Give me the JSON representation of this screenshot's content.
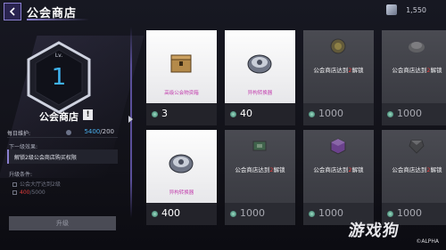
{
  "header": {
    "title": "公会商店",
    "currency_value": "1,550"
  },
  "guild": {
    "lv_label": "Lv.",
    "level": "1",
    "name": "公会商店",
    "info_symbol": "!",
    "maintenance_label": "每日维护:",
    "maintenance_current": "5400",
    "maintenance_max": "/200",
    "next_label": "下一级效果:",
    "next_effect": "解锁2级公会商店购买权限",
    "conditions_label": "升级条件:",
    "condition_1": "公会大厅达到2级",
    "condition_2_current": "400",
    "condition_2_max": "/5000",
    "upgrade_button": "升级"
  },
  "shop": {
    "items": [
      {
        "name": "高级公会物资箱",
        "price": "3",
        "locked": false,
        "lock_text": "",
        "lock_level": "",
        "icon": "crate-icon"
      },
      {
        "name": "异构转换器",
        "price": "40",
        "locked": false,
        "lock_text": "",
        "lock_level": "",
        "icon": "converter-icon"
      },
      {
        "name": "",
        "price": "1000",
        "locked": true,
        "lock_prefix": "公会商店达到",
        "lock_level": "2",
        "lock_suffix": "解锁",
        "icon": "coin-icon"
      },
      {
        "name": "",
        "price": "1000",
        "locked": true,
        "lock_prefix": "公会商店达到",
        "lock_level": "2",
        "lock_suffix": "解锁",
        "icon": "disc-icon"
      },
      {
        "name": "异构转换器",
        "price": "400",
        "locked": false,
        "lock_text": "",
        "lock_level": "",
        "icon": "converter-icon"
      },
      {
        "name": "",
        "price": "1000",
        "locked": true,
        "lock_prefix": "公会商店达到",
        "lock_level": "2",
        "lock_suffix": "解锁",
        "icon": "chip-icon"
      },
      {
        "name": "",
        "price": "1000",
        "locked": true,
        "lock_prefix": "公会商店达到",
        "lock_level": "2",
        "lock_suffix": "解锁",
        "icon": "cube-icon"
      },
      {
        "name": "",
        "price": "1000",
        "locked": true,
        "lock_prefix": "公会商店达到",
        "lock_level": "2",
        "lock_suffix": "解锁",
        "icon": "crystal-icon"
      }
    ]
  },
  "watermark": {
    "logo": "游戏狗",
    "brand": "©ALPHA"
  },
  "colors": {
    "accent": "#8a7fd0",
    "level_blue": "#3fb3ee",
    "lock_red": "#e23c3c",
    "item_name_pink": "#c23dad"
  }
}
